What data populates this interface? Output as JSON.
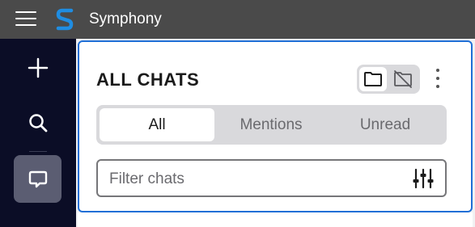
{
  "app": {
    "title": "Symphony",
    "brand_color": "#1f8de2"
  },
  "rail": {
    "items": [
      {
        "icon": "plus-icon"
      },
      {
        "icon": "search-icon"
      },
      {
        "icon": "chat-bubble-icon",
        "active": true
      }
    ]
  },
  "panel": {
    "title": "ALL CHATS",
    "accent_color": "#1f6fd6",
    "folder_toggle": {
      "selected": "folder-icon",
      "other": "folder-off-icon"
    },
    "tabs": [
      {
        "label": "All",
        "active": true
      },
      {
        "label": "Mentions",
        "active": false
      },
      {
        "label": "Unread",
        "active": false
      }
    ],
    "filter": {
      "placeholder": "Filter chats",
      "value": ""
    }
  }
}
